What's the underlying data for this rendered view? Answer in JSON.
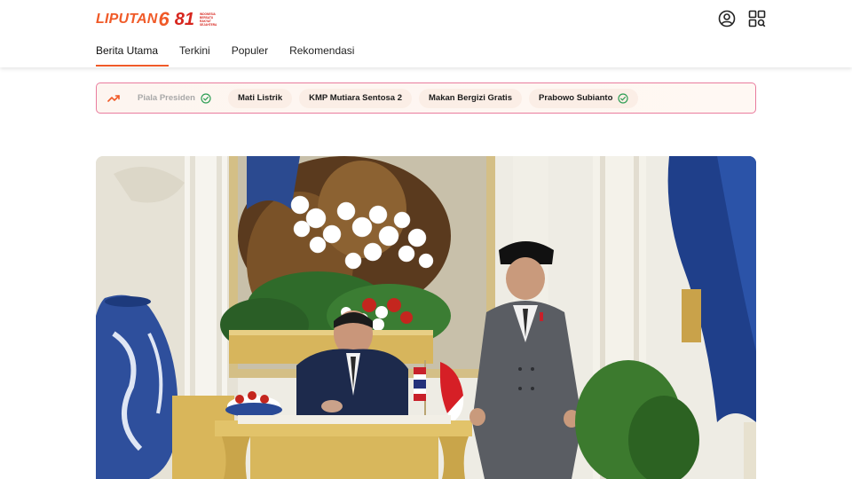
{
  "header": {
    "logo_word": "LIPUTAN",
    "logo_number": "6",
    "anniversary_mark": "81",
    "anniversary_tag": [
      "INDONESIA",
      "BERSATU",
      "RAKYAT",
      "SEJAHTERA"
    ],
    "icons": [
      "user-account-icon",
      "qr-grid-icon"
    ]
  },
  "nav": {
    "tabs": [
      {
        "label": "Berita Utama",
        "active": true
      },
      {
        "label": "Terkini",
        "active": false
      },
      {
        "label": "Populer",
        "active": false
      },
      {
        "label": "Rekomendasi",
        "active": false
      }
    ]
  },
  "trending": {
    "icon": "trending-up-icon",
    "chips": [
      {
        "label": "Piala Presiden",
        "verified": true,
        "faded": true
      },
      {
        "label": "Mati Listrik",
        "verified": false,
        "faded": false
      },
      {
        "label": "KMP Mutiara Sentosa 2",
        "verified": false,
        "faded": false
      },
      {
        "label": "Makan Bergizi Gratis",
        "verified": false,
        "faded": false
      },
      {
        "label": "Prabowo Subianto",
        "verified": true,
        "faded": false
      }
    ]
  },
  "hero": {
    "image": "state-visit-signing-photo"
  },
  "colors": {
    "brand_orange": "#f05a28",
    "brand_red": "#d7261e",
    "trend_border": "#e97c9e",
    "check_green": "#2e9e54"
  }
}
